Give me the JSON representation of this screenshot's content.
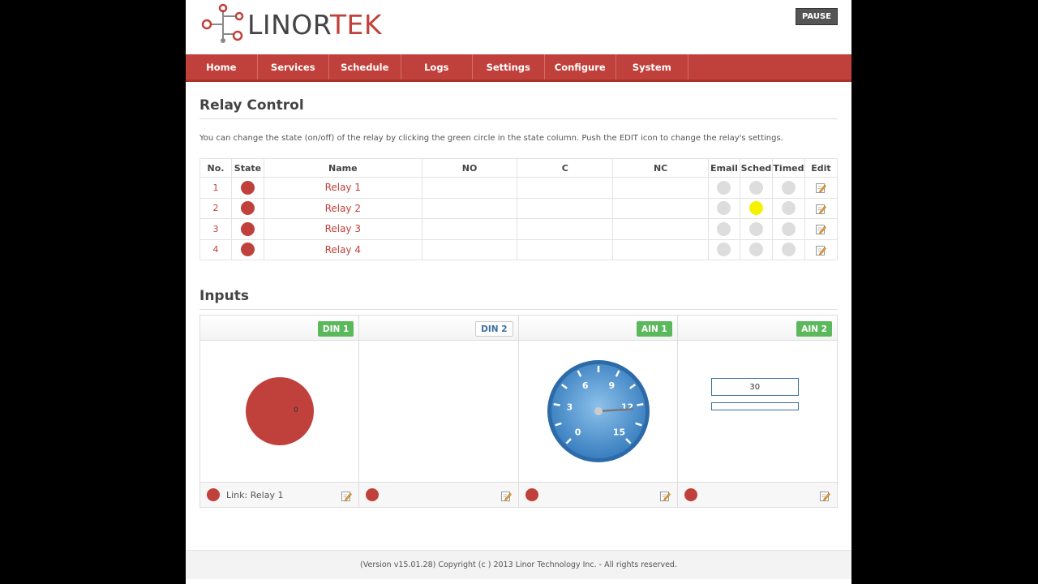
{
  "brand": {
    "logo_text_1": "LINOR",
    "logo_text_2": "TEK",
    "accent": "#c0413b"
  },
  "header": {
    "pause_label": "PAUSE"
  },
  "nav": [
    "Home",
    "Services",
    "Schedule",
    "Logs",
    "Settings",
    "Configure",
    "System"
  ],
  "relay": {
    "title": "Relay Control",
    "description": "You can change the state (on/off) of the relay by clicking the green circle in the state column. Push the EDIT icon to change the relay's settings.",
    "columns": [
      "No.",
      "State",
      "Name",
      "NO",
      "C",
      "NC",
      "Email",
      "Sched",
      "Timed",
      "Edit"
    ],
    "rows": [
      {
        "no": "1",
        "name": "Relay 1",
        "state": "red",
        "email": "grey",
        "sched": "grey",
        "timed": "grey"
      },
      {
        "no": "2",
        "name": "Relay 2",
        "state": "red",
        "email": "grey",
        "sched": "yellow",
        "timed": "grey"
      },
      {
        "no": "3",
        "name": "Relay 3",
        "state": "red",
        "email": "grey",
        "sched": "grey",
        "timed": "grey"
      },
      {
        "no": "4",
        "name": "Relay 4",
        "state": "red",
        "email": "grey",
        "sched": "grey",
        "timed": "grey"
      }
    ]
  },
  "inputs": {
    "title": "Inputs",
    "panels": [
      {
        "badge": "DIN 1",
        "badge_style": "green",
        "value": "0",
        "foot_text": "Link: Relay 1"
      },
      {
        "badge": "DIN 2",
        "badge_style": "white",
        "foot_text": ""
      },
      {
        "badge": "AIN 1",
        "badge_style": "green",
        "foot_text": ""
      },
      {
        "badge": "AIN 2",
        "badge_style": "green",
        "value": "30",
        "foot_text": ""
      }
    ],
    "gauge": {
      "labels": [
        "0",
        "3",
        "6",
        "9",
        "12",
        "15"
      ],
      "min": 0,
      "max": 15,
      "needle_value": 12.3
    }
  },
  "footer": {
    "text": "(Version v15.01.28) Copyright (c ) 2013 Linor Technology Inc. - All rights reserved."
  }
}
